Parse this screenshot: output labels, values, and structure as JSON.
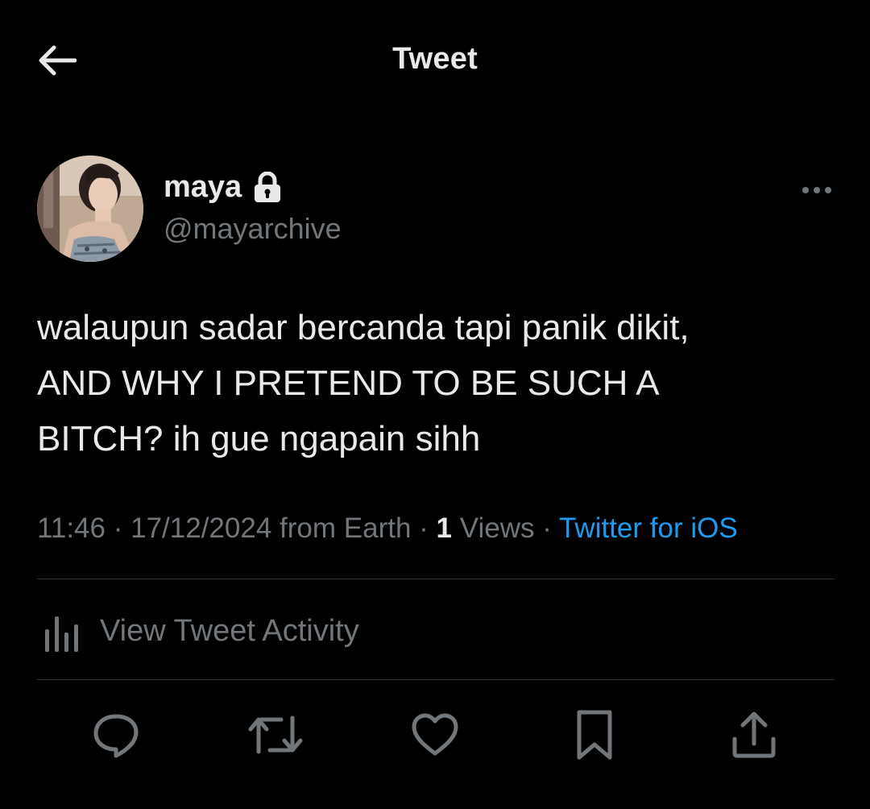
{
  "header": {
    "title": "Tweet",
    "back_icon": "arrow-left-icon"
  },
  "author": {
    "display_name": "maya",
    "handle": "@mayarchive",
    "protected_icon": "lock-icon",
    "more_icon": "ellipsis-icon"
  },
  "tweet": {
    "text_lines": [
      "walaupun sadar bercanda tapi panik dikit,",
      "AND WHY I PRETEND TO BE SUCH A",
      "BITCH? ih gue ngapain sihh"
    ],
    "time": "11:46",
    "separator": "·",
    "date": "17/12/2024",
    "location": "from Earth",
    "views_count": "1",
    "views_label": "Views",
    "source": "Twitter for iOS"
  },
  "activity": {
    "label": "View Tweet Activity",
    "icon": "bar-chart-icon"
  },
  "actions": [
    {
      "name": "reply",
      "icon": "reply-icon"
    },
    {
      "name": "retweet",
      "icon": "retweet-icon"
    },
    {
      "name": "like",
      "icon": "heart-icon"
    },
    {
      "name": "bookmark",
      "icon": "bookmark-icon"
    },
    {
      "name": "share",
      "icon": "share-icon"
    }
  ],
  "colors": {
    "background": "#000000",
    "text": "#e7e9ea",
    "secondary_text": "#71767b",
    "link": "#1d9bf0",
    "divider": "#2f3336"
  }
}
